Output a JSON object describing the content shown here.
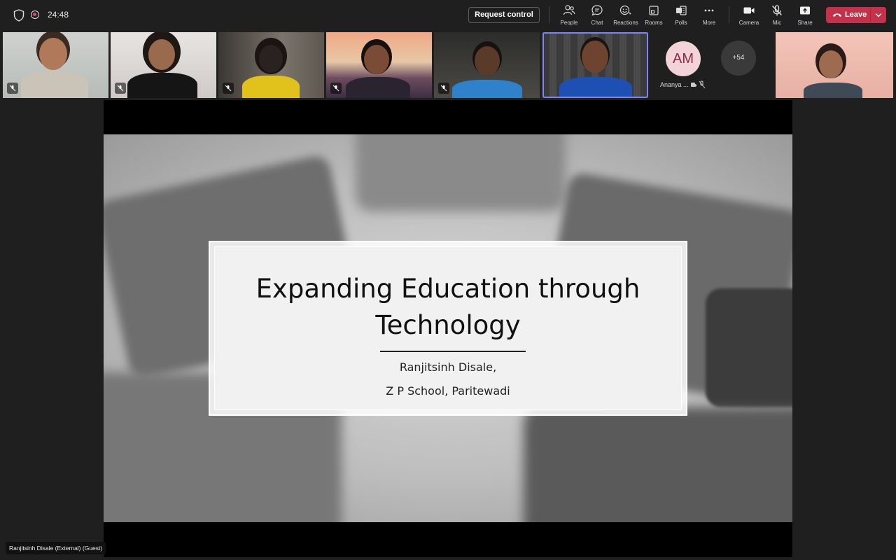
{
  "status": {
    "timer": "24:48"
  },
  "toolbar": {
    "request_control": "Request control",
    "people": "People",
    "chat": "Chat",
    "reactions": "Reactions",
    "rooms": "Rooms",
    "polls": "Polls",
    "more": "More",
    "camera": "Camera",
    "mic": "Mic",
    "share": "Share",
    "leave": "Leave"
  },
  "participants": {
    "avatar_initials": "AM",
    "avatar_name": "Ananya ...",
    "overflow_count": "+54"
  },
  "slide": {
    "title_line1": "Expanding Education through",
    "title_line2": "Technology",
    "author": "Ranjitsinh Disale,",
    "school": "Z P School, Paritewadi"
  },
  "presenter_label": "Ranjitsinh Disale (External) (Guest)",
  "colors": {
    "leave_red": "#c4314b",
    "active_speaker_border": "#7f85f5",
    "background": "#1f1f1f"
  }
}
